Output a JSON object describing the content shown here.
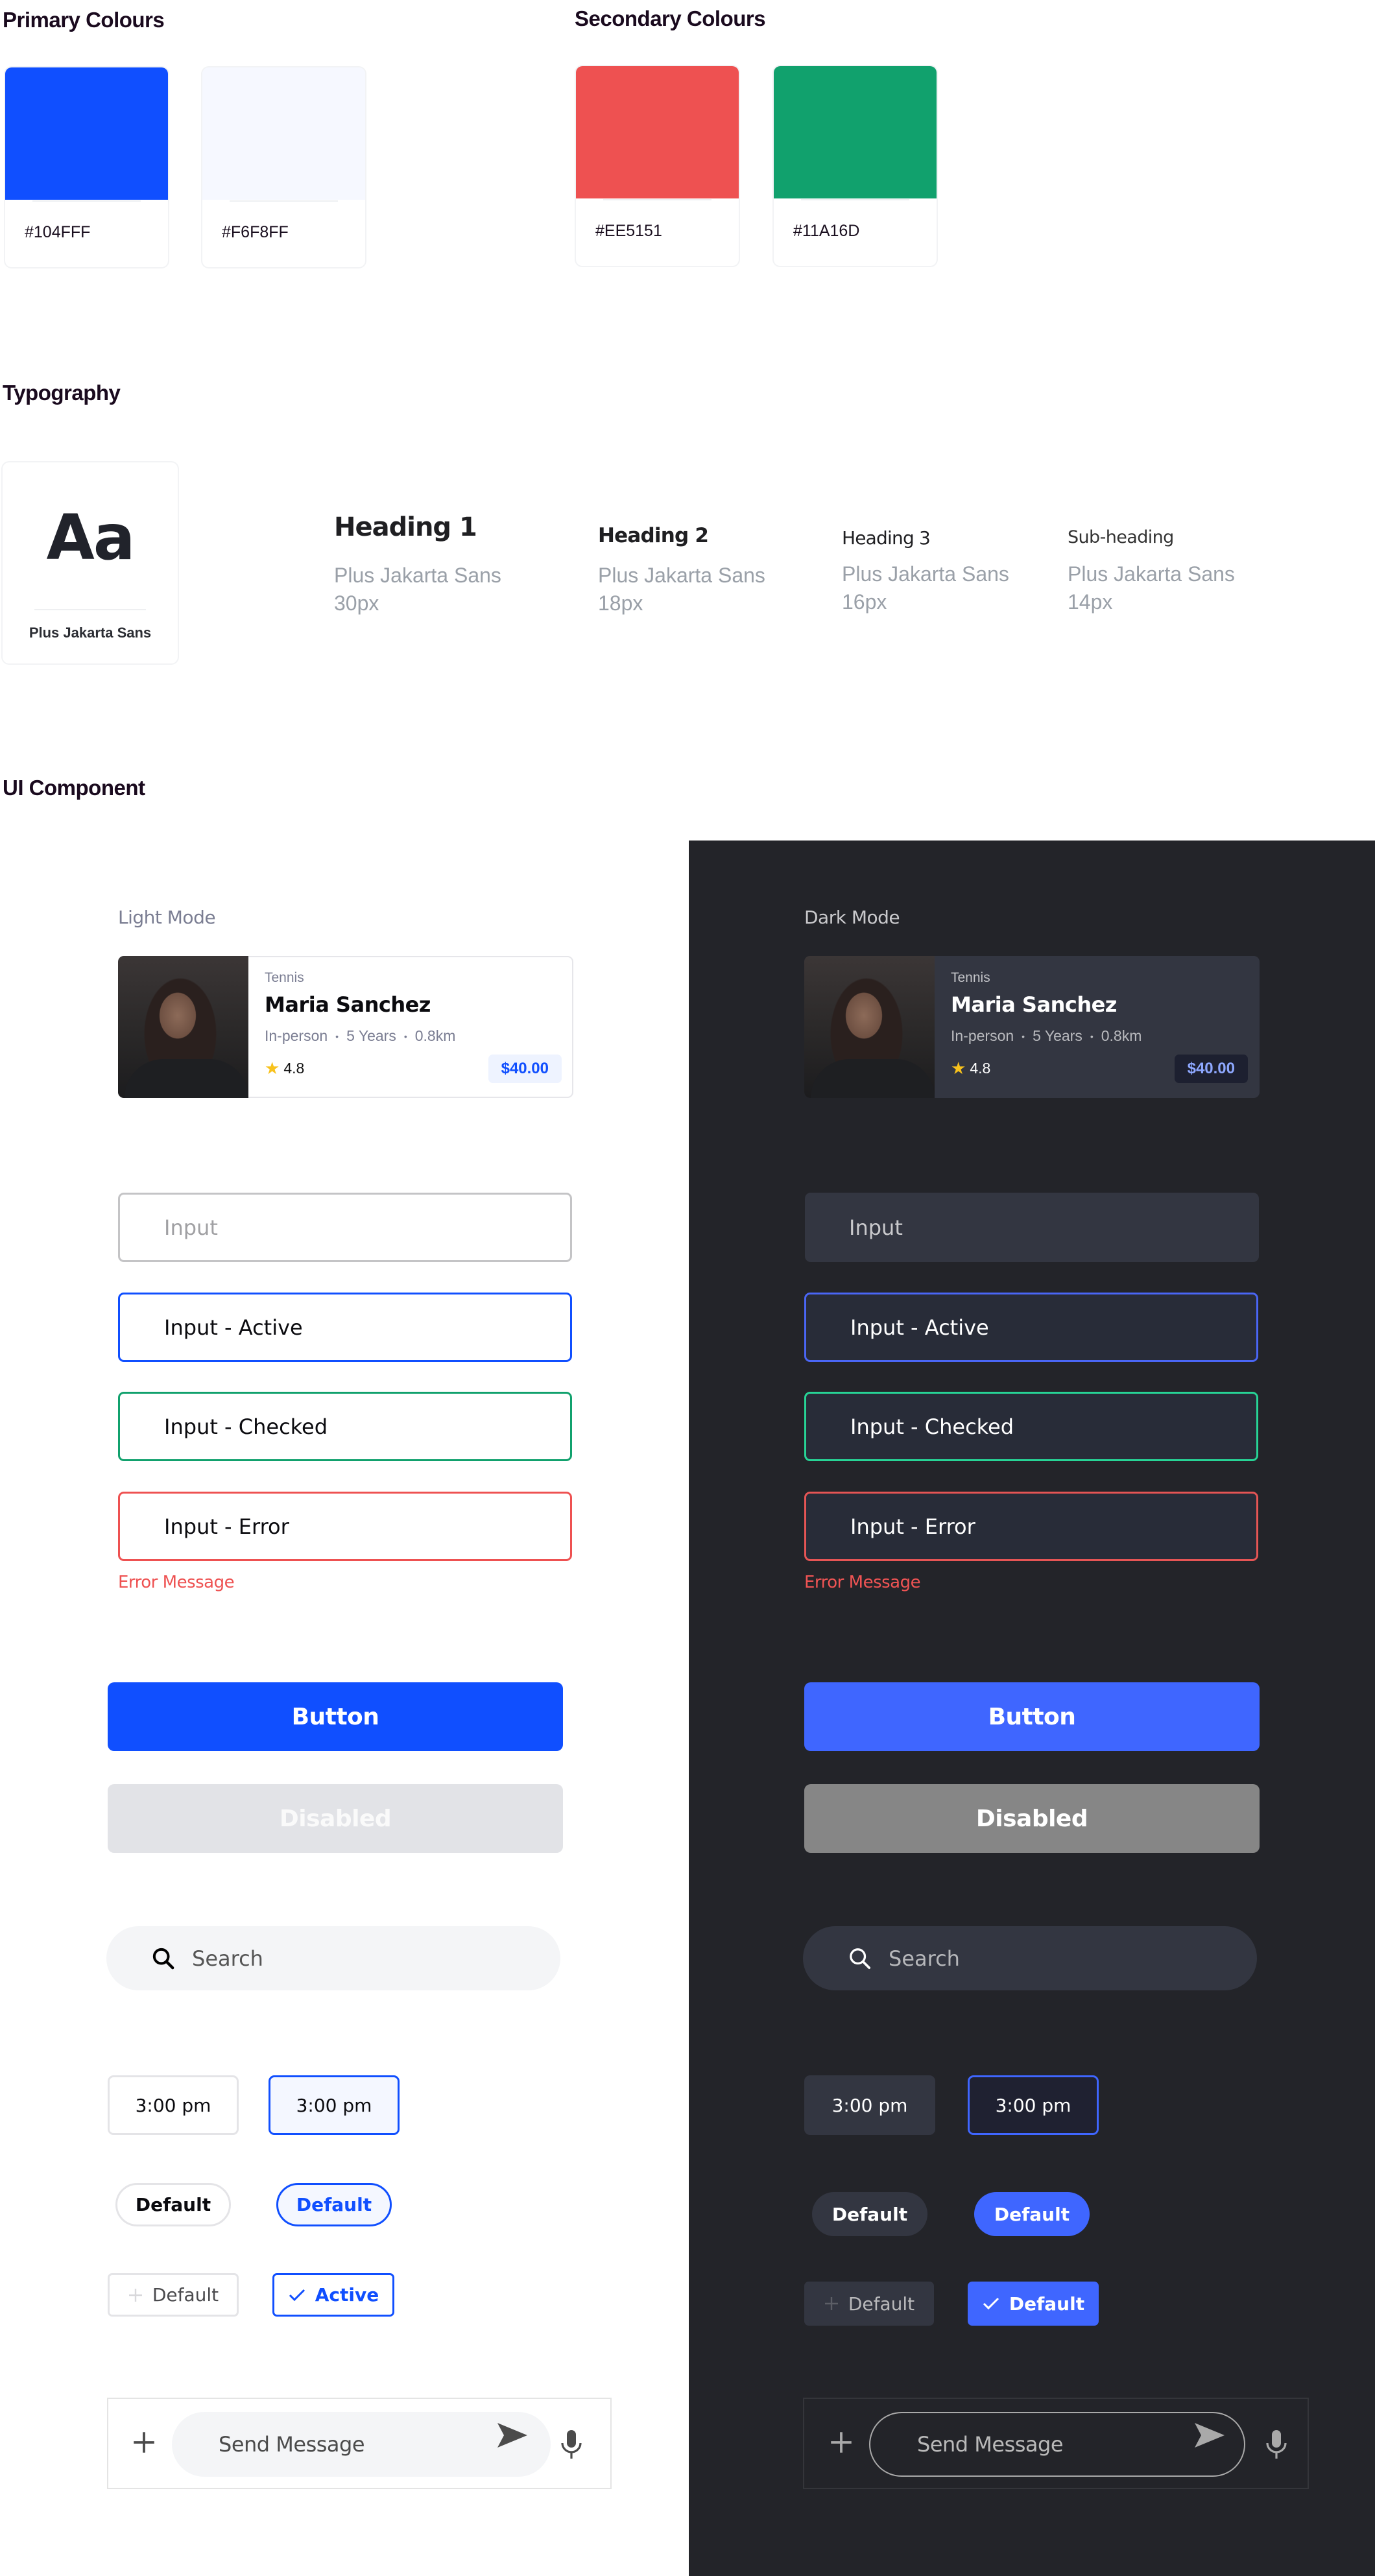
{
  "sections": {
    "primary_colours": "Primary Colours",
    "secondary_colours": "Secondary Colours",
    "typography": "Typography",
    "ui_component": "UI Component"
  },
  "colours": {
    "primary": [
      {
        "hex_label": "#104FFF",
        "color": "#104FFF"
      },
      {
        "hex_label": "#F6F8FF",
        "color": "#F6F8FF"
      }
    ],
    "secondary": [
      {
        "hex_label": "#EE5151",
        "color": "#EE5151"
      },
      {
        "hex_label": "#11A16D",
        "color": "#11A16D"
      }
    ]
  },
  "typography": {
    "sample_glyphs": "Aa",
    "font_name": "Plus Jakarta Sans",
    "styles": [
      {
        "name": "Heading 1",
        "font": "Plus Jakarta Sans",
        "size": "30px"
      },
      {
        "name": "Heading 2",
        "font": "Plus Jakarta Sans",
        "size": "18px"
      },
      {
        "name": "Heading 3",
        "font": "Plus Jakarta Sans",
        "size": "16px"
      },
      {
        "name": "Sub-heading",
        "font": "Plus Jakarta Sans",
        "size": "14px"
      }
    ]
  },
  "modes": {
    "light": {
      "label": "Light Mode",
      "card": {
        "sport": "Tennis",
        "name": "Maria Sanchez",
        "meta": [
          "In-person",
          "5 Years",
          "0.8km"
        ],
        "rating": "4.8",
        "price": "$40.00"
      },
      "inputs": {
        "default": "Input",
        "active": "Input - Active",
        "checked": "Input - Checked",
        "error": "Input - Error",
        "error_message": "Error Message"
      },
      "buttons": {
        "primary": "Button",
        "disabled": "Disabled"
      },
      "search": {
        "placeholder": "Search"
      },
      "time_chips": [
        "3:00 pm",
        "3:00 pm"
      ],
      "pills": [
        "Default",
        "Default"
      ],
      "tags": [
        "Default",
        "Active"
      ],
      "message": {
        "placeholder": "Send Message"
      }
    },
    "dark": {
      "label": "Dark Mode",
      "card": {
        "sport": "Tennis",
        "name": "Maria Sanchez",
        "meta": [
          "In-person",
          "5 Years",
          "0.8km"
        ],
        "rating": "4.8",
        "price": "$40.00"
      },
      "inputs": {
        "default": "Input",
        "active": "Input - Active",
        "checked": "Input - Checked",
        "error": "Input - Error",
        "error_message": "Error Message"
      },
      "buttons": {
        "primary": "Button",
        "disabled": "Disabled"
      },
      "search": {
        "placeholder": "Search"
      },
      "time_chips": [
        "3:00 pm",
        "3:00 pm"
      ],
      "pills": [
        "Default",
        "Default"
      ],
      "tags": [
        "Default",
        "Default"
      ],
      "message": {
        "placeholder": "Send Message"
      }
    }
  },
  "meta_separator": "•",
  "star_glyph": "★"
}
